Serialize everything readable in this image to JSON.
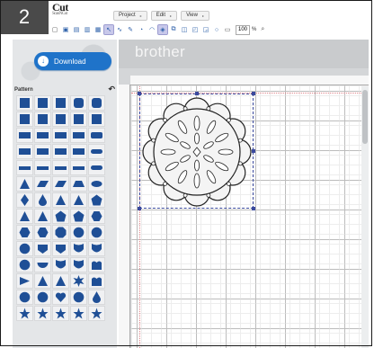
{
  "step": {
    "number": "2"
  },
  "app": {
    "logo_text": "Cut",
    "logo_sub": "ScanNCut"
  },
  "menu": [
    {
      "label": "Project",
      "caret": "▸"
    },
    {
      "label": "Edit",
      "caret": "▸"
    },
    {
      "label": "View",
      "caret": "▸"
    }
  ],
  "toolbar": {
    "zoom_value": "100",
    "zoom_unit": "%",
    "icons": [
      "new-icon",
      "open-icon",
      "save-icon",
      "export-icon",
      "import-icon",
      "select-icon",
      "pen-icon",
      "pencil-icon",
      "draw-icon",
      "curve-icon",
      "node-icon",
      "weld-icon",
      "group-icon",
      "ungroup-icon",
      "trace-icon",
      "circle-icon",
      "rectangle-icon",
      "zoom-icon"
    ]
  },
  "sidebar": {
    "download_label": "Download",
    "pattern_label": "Pattern",
    "shape_colors": {
      "fill": "#1f4f96"
    }
  },
  "canvas": {
    "brand": "brother",
    "accent": "#3b4a9e",
    "margin_color": "#e0848a"
  }
}
